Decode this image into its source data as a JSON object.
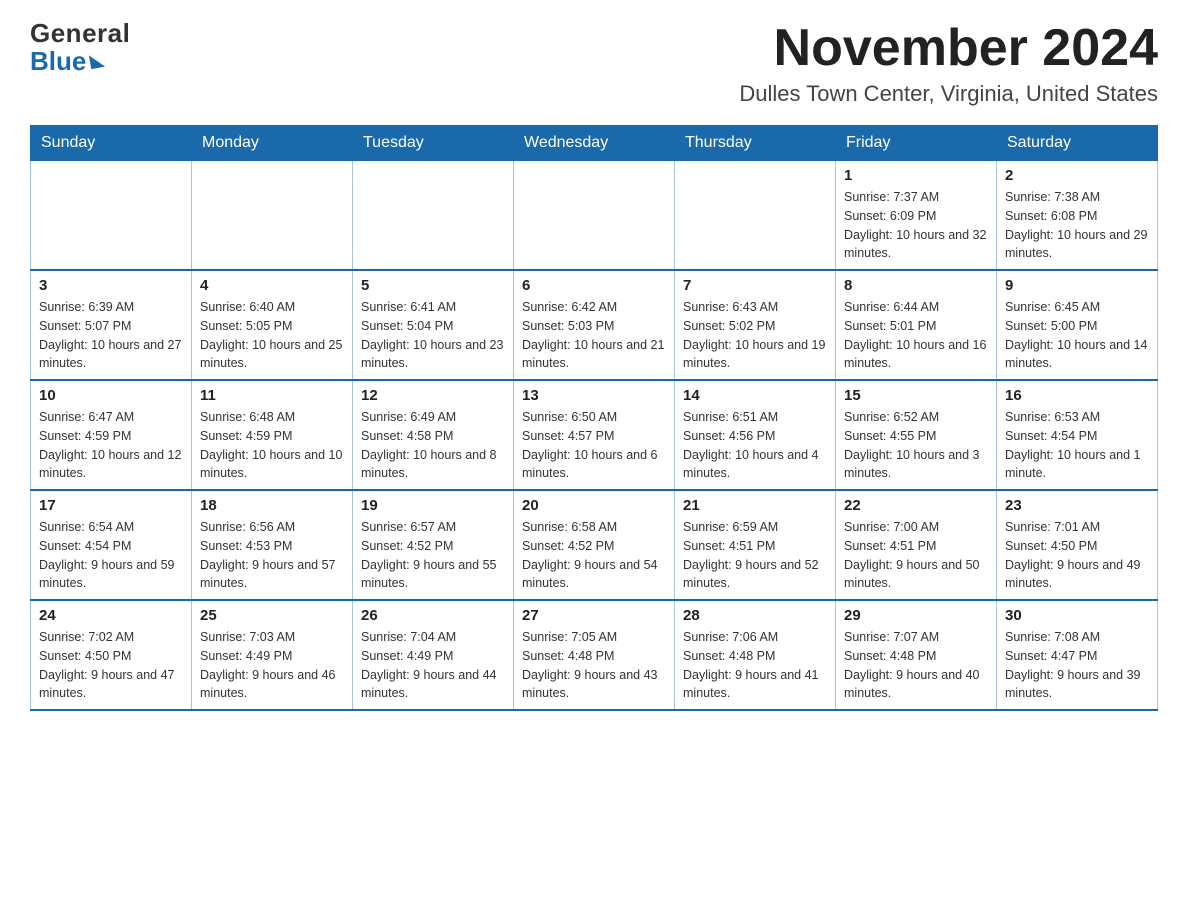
{
  "logo": {
    "general": "General",
    "blue": "Blue"
  },
  "header": {
    "month_year": "November 2024",
    "location": "Dulles Town Center, Virginia, United States"
  },
  "weekdays": [
    "Sunday",
    "Monday",
    "Tuesday",
    "Wednesday",
    "Thursday",
    "Friday",
    "Saturday"
  ],
  "weeks": [
    [
      {
        "day": "",
        "info": ""
      },
      {
        "day": "",
        "info": ""
      },
      {
        "day": "",
        "info": ""
      },
      {
        "day": "",
        "info": ""
      },
      {
        "day": "",
        "info": ""
      },
      {
        "day": "1",
        "info": "Sunrise: 7:37 AM\nSunset: 6:09 PM\nDaylight: 10 hours and 32 minutes."
      },
      {
        "day": "2",
        "info": "Sunrise: 7:38 AM\nSunset: 6:08 PM\nDaylight: 10 hours and 29 minutes."
      }
    ],
    [
      {
        "day": "3",
        "info": "Sunrise: 6:39 AM\nSunset: 5:07 PM\nDaylight: 10 hours and 27 minutes."
      },
      {
        "day": "4",
        "info": "Sunrise: 6:40 AM\nSunset: 5:05 PM\nDaylight: 10 hours and 25 minutes."
      },
      {
        "day": "5",
        "info": "Sunrise: 6:41 AM\nSunset: 5:04 PM\nDaylight: 10 hours and 23 minutes."
      },
      {
        "day": "6",
        "info": "Sunrise: 6:42 AM\nSunset: 5:03 PM\nDaylight: 10 hours and 21 minutes."
      },
      {
        "day": "7",
        "info": "Sunrise: 6:43 AM\nSunset: 5:02 PM\nDaylight: 10 hours and 19 minutes."
      },
      {
        "day": "8",
        "info": "Sunrise: 6:44 AM\nSunset: 5:01 PM\nDaylight: 10 hours and 16 minutes."
      },
      {
        "day": "9",
        "info": "Sunrise: 6:45 AM\nSunset: 5:00 PM\nDaylight: 10 hours and 14 minutes."
      }
    ],
    [
      {
        "day": "10",
        "info": "Sunrise: 6:47 AM\nSunset: 4:59 PM\nDaylight: 10 hours and 12 minutes."
      },
      {
        "day": "11",
        "info": "Sunrise: 6:48 AM\nSunset: 4:59 PM\nDaylight: 10 hours and 10 minutes."
      },
      {
        "day": "12",
        "info": "Sunrise: 6:49 AM\nSunset: 4:58 PM\nDaylight: 10 hours and 8 minutes."
      },
      {
        "day": "13",
        "info": "Sunrise: 6:50 AM\nSunset: 4:57 PM\nDaylight: 10 hours and 6 minutes."
      },
      {
        "day": "14",
        "info": "Sunrise: 6:51 AM\nSunset: 4:56 PM\nDaylight: 10 hours and 4 minutes."
      },
      {
        "day": "15",
        "info": "Sunrise: 6:52 AM\nSunset: 4:55 PM\nDaylight: 10 hours and 3 minutes."
      },
      {
        "day": "16",
        "info": "Sunrise: 6:53 AM\nSunset: 4:54 PM\nDaylight: 10 hours and 1 minute."
      }
    ],
    [
      {
        "day": "17",
        "info": "Sunrise: 6:54 AM\nSunset: 4:54 PM\nDaylight: 9 hours and 59 minutes."
      },
      {
        "day": "18",
        "info": "Sunrise: 6:56 AM\nSunset: 4:53 PM\nDaylight: 9 hours and 57 minutes."
      },
      {
        "day": "19",
        "info": "Sunrise: 6:57 AM\nSunset: 4:52 PM\nDaylight: 9 hours and 55 minutes."
      },
      {
        "day": "20",
        "info": "Sunrise: 6:58 AM\nSunset: 4:52 PM\nDaylight: 9 hours and 54 minutes."
      },
      {
        "day": "21",
        "info": "Sunrise: 6:59 AM\nSunset: 4:51 PM\nDaylight: 9 hours and 52 minutes."
      },
      {
        "day": "22",
        "info": "Sunrise: 7:00 AM\nSunset: 4:51 PM\nDaylight: 9 hours and 50 minutes."
      },
      {
        "day": "23",
        "info": "Sunrise: 7:01 AM\nSunset: 4:50 PM\nDaylight: 9 hours and 49 minutes."
      }
    ],
    [
      {
        "day": "24",
        "info": "Sunrise: 7:02 AM\nSunset: 4:50 PM\nDaylight: 9 hours and 47 minutes."
      },
      {
        "day": "25",
        "info": "Sunrise: 7:03 AM\nSunset: 4:49 PM\nDaylight: 9 hours and 46 minutes."
      },
      {
        "day": "26",
        "info": "Sunrise: 7:04 AM\nSunset: 4:49 PM\nDaylight: 9 hours and 44 minutes."
      },
      {
        "day": "27",
        "info": "Sunrise: 7:05 AM\nSunset: 4:48 PM\nDaylight: 9 hours and 43 minutes."
      },
      {
        "day": "28",
        "info": "Sunrise: 7:06 AM\nSunset: 4:48 PM\nDaylight: 9 hours and 41 minutes."
      },
      {
        "day": "29",
        "info": "Sunrise: 7:07 AM\nSunset: 4:48 PM\nDaylight: 9 hours and 40 minutes."
      },
      {
        "day": "30",
        "info": "Sunrise: 7:08 AM\nSunset: 4:47 PM\nDaylight: 9 hours and 39 minutes."
      }
    ]
  ]
}
